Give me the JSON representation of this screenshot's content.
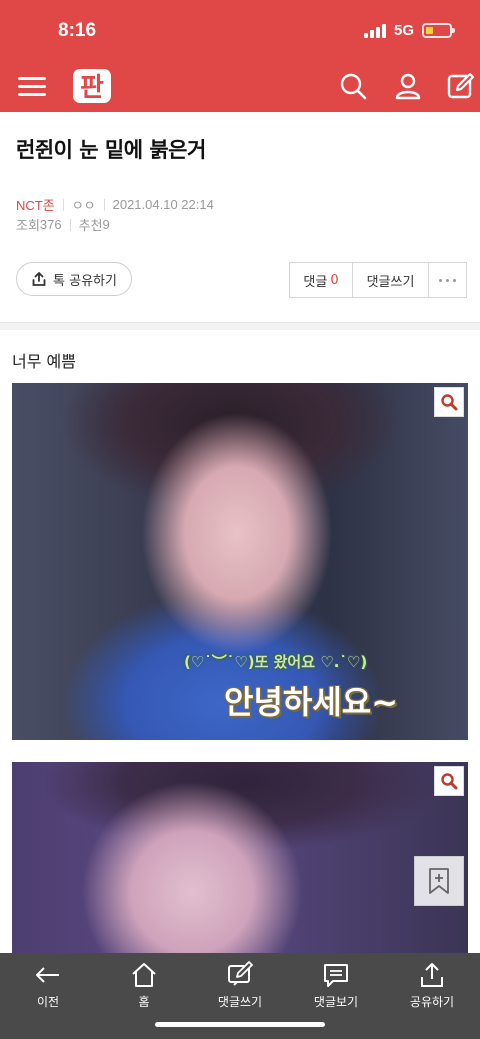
{
  "status": {
    "time": "8:16",
    "network": "5G",
    "battery_level": 0.3,
    "battery_color": "#f5d33a"
  },
  "app": {
    "brand_color": "#e04747",
    "logo": "판",
    "icons": [
      "menu-icon",
      "search-icon",
      "user-icon",
      "write-icon"
    ]
  },
  "post": {
    "title": "런쥔이 눈 밑에 붉은거",
    "board": "NCT존",
    "author": "ㅇㅇ",
    "datetime": "2021.04.10 22:14",
    "views_label": "조회",
    "views": "376",
    "recommend_label": "추천",
    "recommend": "9",
    "body": "너무 예쁨"
  },
  "actions": {
    "share_kakao": "톡 공유하기",
    "comments_label": "댓글",
    "comments_count": "0",
    "write_comment": "댓글쓰기"
  },
  "images": [
    {
      "caption_small": "(♡˙︶˙♡)또 왔어요 ♡.˙♡)",
      "caption_big": "안녕하세요~"
    },
    {
      "caption_small": "",
      "caption_big": ""
    }
  ],
  "bottom_nav": [
    {
      "label": "이전",
      "icon": "back-arrow-icon"
    },
    {
      "label": "홈",
      "icon": "home-icon"
    },
    {
      "label": "댓글쓰기",
      "icon": "write-comment-icon"
    },
    {
      "label": "댓글보기",
      "icon": "view-comments-icon"
    },
    {
      "label": "공유하기",
      "icon": "share-icon"
    }
  ]
}
